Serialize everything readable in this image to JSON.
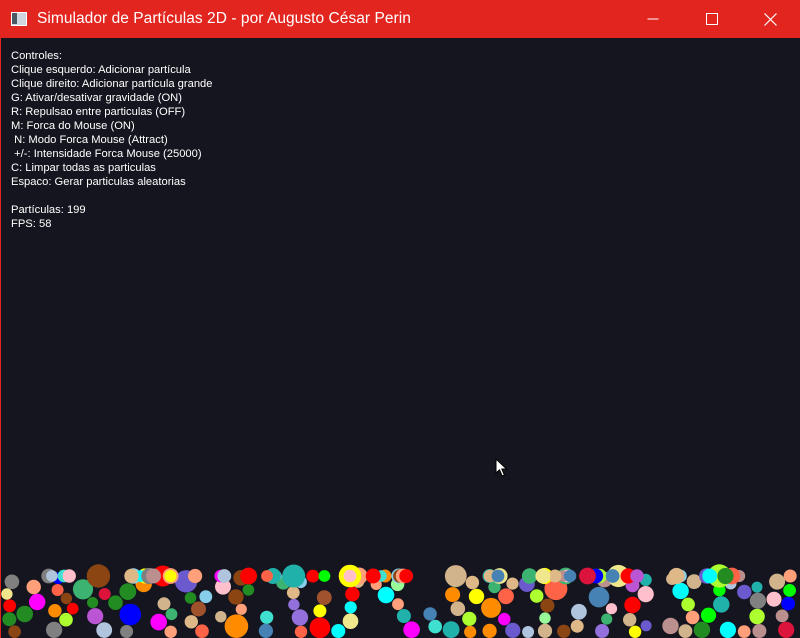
{
  "window": {
    "title": "Simulador de Partículas 2D - por Augusto César Perin",
    "accent_color": "#e2261f",
    "background_color": "#15151f",
    "buttons": {
      "minimize_icon": "minimize-icon",
      "maximize_icon": "maximize-icon",
      "close_icon": "close-icon"
    }
  },
  "overlay": {
    "heading": "Controles:",
    "controls": [
      "Clique esquerdo: Adicionar partícula",
      "Clique direito: Adicionar partícula grande",
      "G: Ativar/desativar gravidade (ON)",
      "R: Repulsao entre particulas (OFF)",
      "M: Forca do Mouse (ON)",
      " N: Modo Forca Mouse (Attract)",
      " +/-: Intensidade Forca Mouse (25000)",
      "C: Limpar todas as particulas",
      "Espaco: Gerar particulas aleatorias"
    ],
    "particle_count": "Partículas: 199",
    "fps": "FPS: 58"
  },
  "simulation": {
    "particle_count": 199,
    "palette": [
      "#ff0000",
      "#00ff00",
      "#0000ff",
      "#ffff00",
      "#ff00ff",
      "#00ffff",
      "#ff8c00",
      "#8b4513",
      "#808080",
      "#ffc0cb",
      "#9370db",
      "#40e0d0",
      "#deb887",
      "#a0522d",
      "#98fb98",
      "#b0c4de",
      "#ffa07a",
      "#6a5acd",
      "#3cb371",
      "#d2b48c",
      "#20b2aa",
      "#ff6347",
      "#4682b4",
      "#adff2f",
      "#ba55d3",
      "#f0e68c",
      "#87ceeb",
      "#228b22",
      "#dc143c",
      "#bc8f8f"
    ]
  }
}
